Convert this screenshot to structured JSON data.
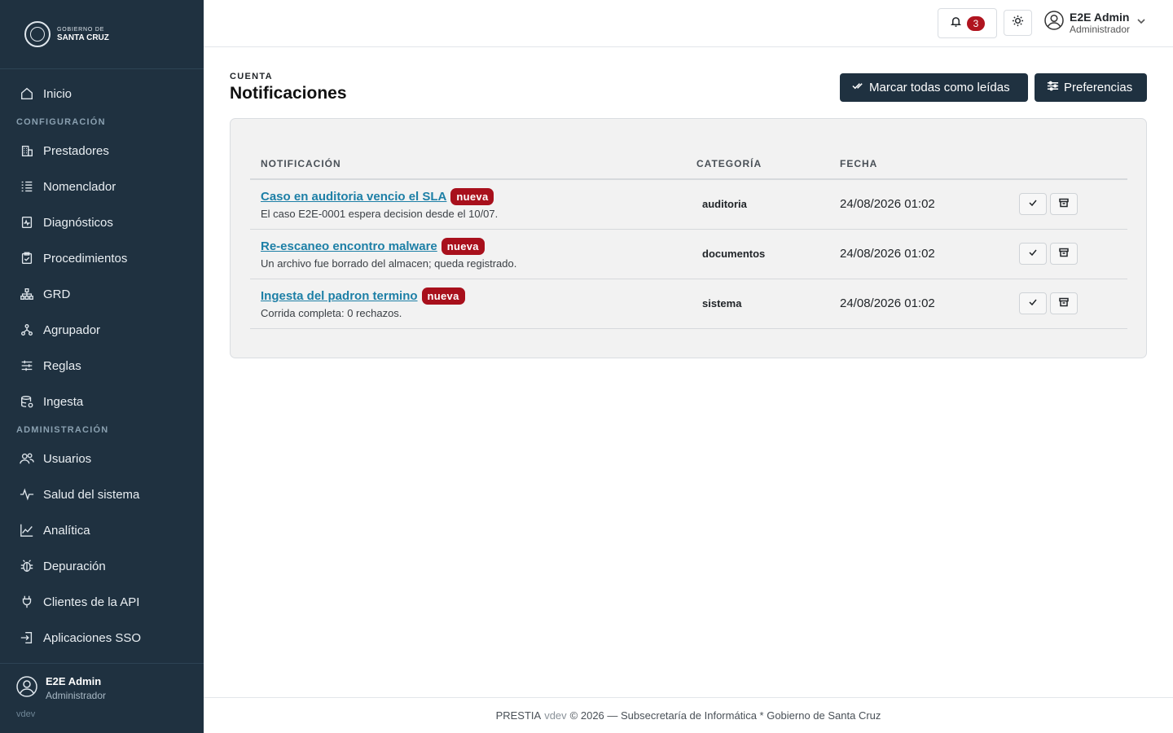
{
  "brand": {
    "line1": "GOBIERNO DE",
    "line2": "SANTA CRUZ"
  },
  "sidebar": {
    "home": {
      "label": "Inicio",
      "icon": "home-icon"
    },
    "section_config": "CONFIGURACIÓN",
    "config_items": [
      {
        "label": "Prestadores",
        "icon": "building-icon"
      },
      {
        "label": "Nomenclador",
        "icon": "list-icon"
      },
      {
        "label": "Diagnósticos",
        "icon": "chart-file-icon"
      },
      {
        "label": "Procedimientos",
        "icon": "clipboard-icon"
      },
      {
        "label": "GRD",
        "icon": "hierarchy-icon"
      },
      {
        "label": "Agrupador",
        "icon": "group-icon"
      },
      {
        "label": "Reglas",
        "icon": "sliders-icon"
      },
      {
        "label": "Ingesta",
        "icon": "database-icon"
      }
    ],
    "section_admin": "ADMINISTRACIÓN",
    "admin_items": [
      {
        "label": "Usuarios",
        "icon": "users-icon"
      },
      {
        "label": "Salud del sistema",
        "icon": "pulse-icon"
      },
      {
        "label": "Analítica",
        "icon": "line-chart-icon"
      },
      {
        "label": "Depuración",
        "icon": "bug-icon"
      },
      {
        "label": "Clientes de la API",
        "icon": "plug-icon"
      },
      {
        "label": "Aplicaciones SSO",
        "icon": "sign-in-icon"
      }
    ],
    "footer": {
      "name": "E2E Admin",
      "role": "Administrador",
      "version": "vdev"
    }
  },
  "topbar": {
    "notification_count": "3",
    "user": {
      "name": "E2E Admin",
      "role": "Administrador"
    }
  },
  "page": {
    "eyebrow": "CUENTA",
    "title": "Notificaciones",
    "mark_all_label": "Marcar todas como leídas",
    "preferences_label": "Preferencias"
  },
  "table": {
    "headers": {
      "notification": "NOTIFICACIÓN",
      "category": "CATEGORÍA",
      "date": "FECHA"
    },
    "rows": [
      {
        "title": "Caso en auditoria vencio el SLA",
        "badge": "nueva",
        "desc": "El caso E2E-0001 espera decision desde el 10/07.",
        "category": "auditoria",
        "date": "24/08/2026 01:02"
      },
      {
        "title": "Re-escaneo encontro malware",
        "badge": "nueva",
        "desc": "Un archivo fue borrado del almacen; queda registrado.",
        "category": "documentos",
        "date": "24/08/2026 01:02"
      },
      {
        "title": "Ingesta del padron termino",
        "badge": "nueva",
        "desc": "Corrida completa: 0 rechazos.",
        "category": "sistema",
        "date": "24/08/2026 01:02"
      }
    ]
  },
  "footer": {
    "app": "PRESTIA",
    "version": "vdev",
    "rest": "© 2026 — Subsecretaría de Informática * Gobierno de Santa Cruz"
  },
  "colors": {
    "sidebar_bg": "#1f3140",
    "accent_link": "#1d7fa6",
    "badge_red": "#a8101c"
  }
}
